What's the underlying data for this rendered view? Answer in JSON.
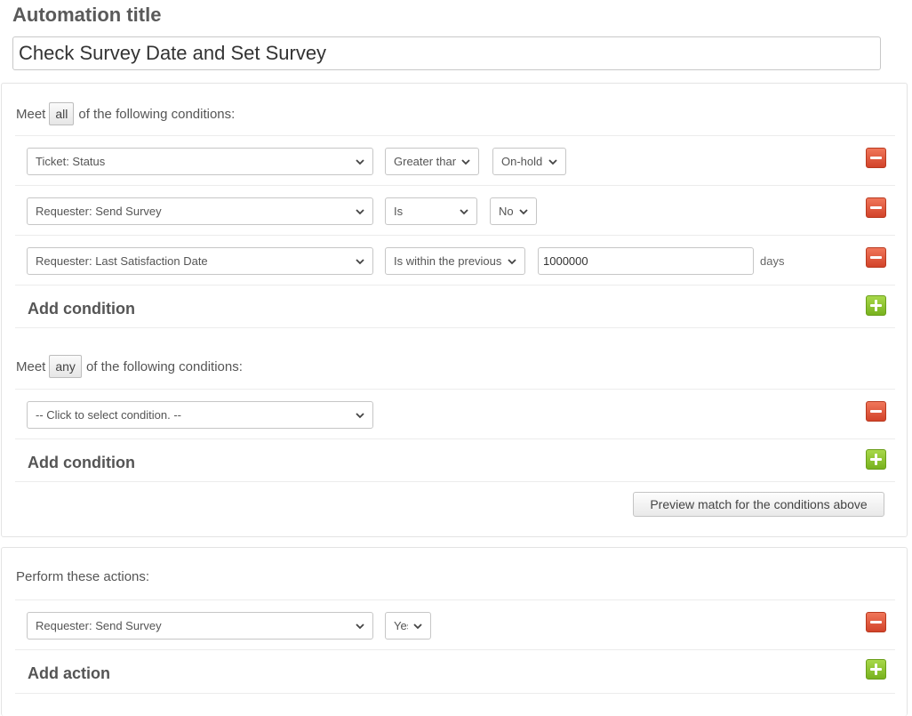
{
  "automation": {
    "title_label": "Automation title",
    "title_value": "Check Survey Date and Set Survey"
  },
  "conditions_all": {
    "prefix": "Meet",
    "quantifier": "all",
    "suffix": "of the following conditions:",
    "rows": [
      {
        "field": "Ticket: Status",
        "operator": "Greater than",
        "value": "On-hold"
      },
      {
        "field": "Requester: Send Survey",
        "operator": "Is",
        "value": "No"
      },
      {
        "field": "Requester: Last Satisfaction Date",
        "operator": "Is within the previous",
        "value": "1000000",
        "unit": "days"
      }
    ],
    "add_label": "Add condition"
  },
  "conditions_any": {
    "prefix": "Meet",
    "quantifier": "any",
    "suffix": "of the following conditions:",
    "rows": [
      {
        "field": "-- Click to select condition. --"
      }
    ],
    "add_label": "Add condition"
  },
  "preview_button_label": "Preview match for the conditions above",
  "actions": {
    "heading": "Perform these actions:",
    "rows": [
      {
        "field": "Requester: Send Survey",
        "value": "Yes"
      }
    ],
    "add_label": "Add action"
  },
  "colors": {
    "remove_button": "#d9472c",
    "add_button": "#86bf26",
    "text": "#555555"
  }
}
